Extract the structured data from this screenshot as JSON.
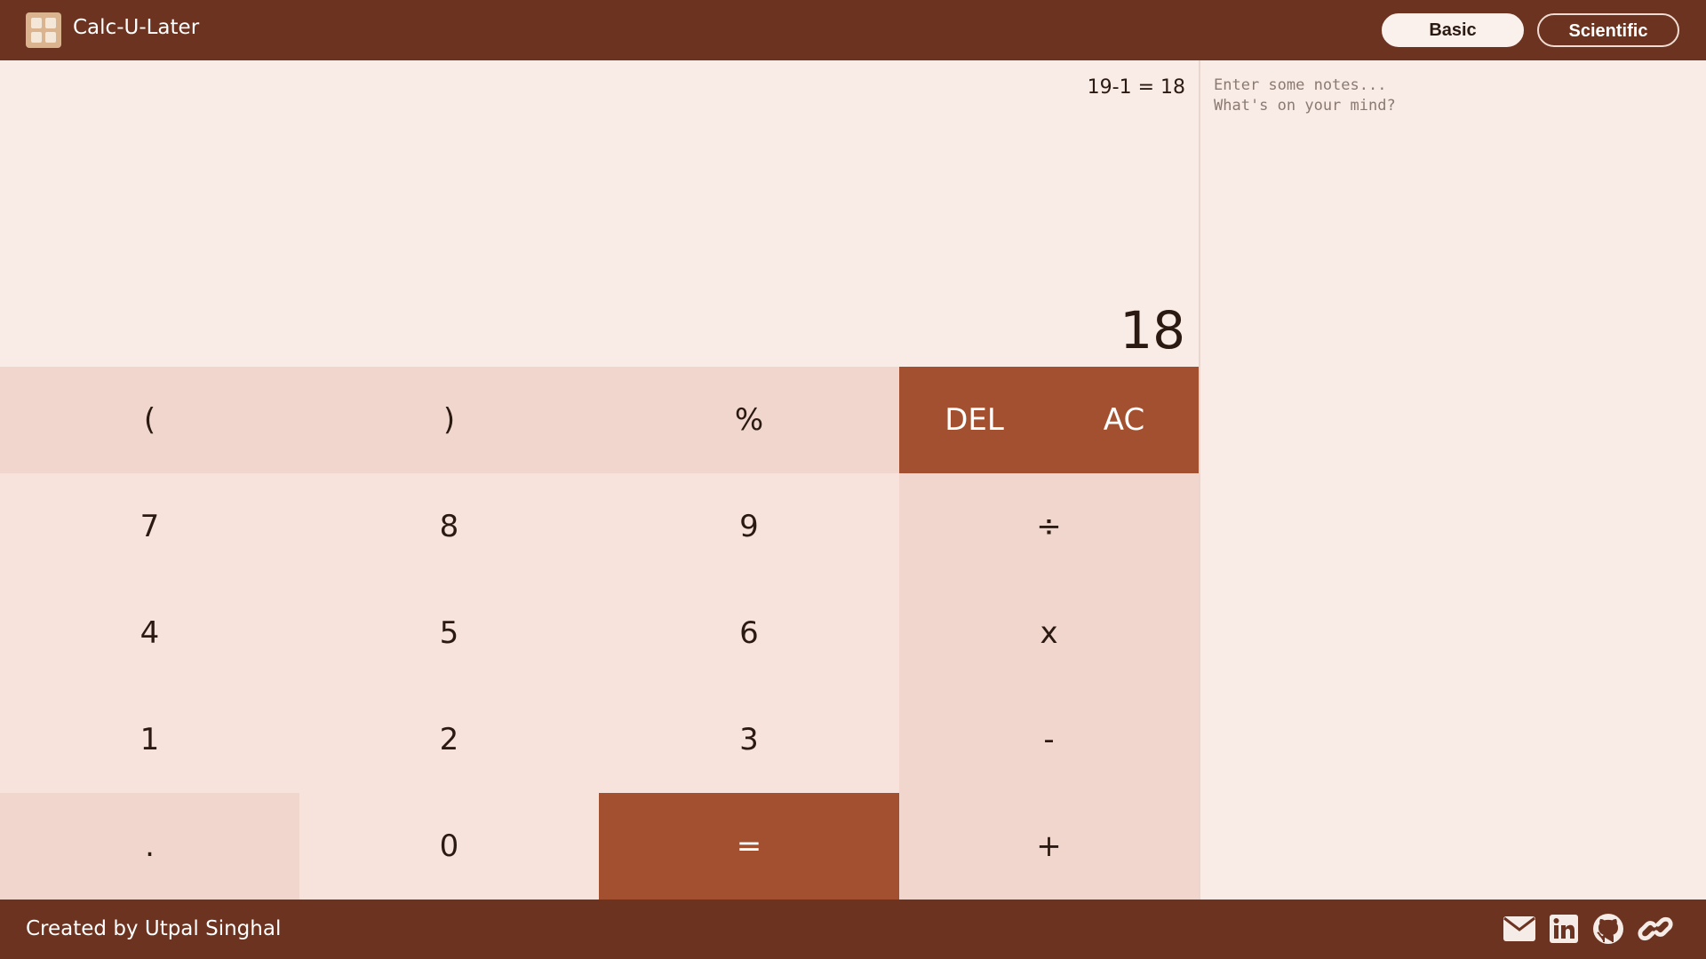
{
  "app": {
    "title": "Calc-U-Later",
    "logo_icon": "calculator-icon"
  },
  "header": {
    "modes": [
      {
        "label": "Basic",
        "active": true
      },
      {
        "label": "Scientific",
        "active": false
      }
    ]
  },
  "display": {
    "history": "19-1 = 18",
    "result": "18"
  },
  "keypad": {
    "keys": [
      "(",
      ")",
      "%",
      "DEL",
      "AC",
      "7",
      "8",
      "9",
      "÷",
      "4",
      "5",
      "6",
      "x",
      "1",
      "2",
      "3",
      "-",
      ".",
      "0",
      "=",
      "+"
    ]
  },
  "notes": {
    "placeholder": "Enter some notes...\nWhat's on your mind?",
    "value": ""
  },
  "footer": {
    "credit": "Created by Utpal Singhal",
    "links": [
      "mail-icon",
      "linkedin-icon",
      "github-icon",
      "link-icon"
    ]
  },
  "colors": {
    "header_bg": "#6b3320",
    "accent": "#a35030",
    "display_bg": "#f9ece6",
    "key_light": "#f7e3dc",
    "key_mid": "#f0d6cd"
  }
}
